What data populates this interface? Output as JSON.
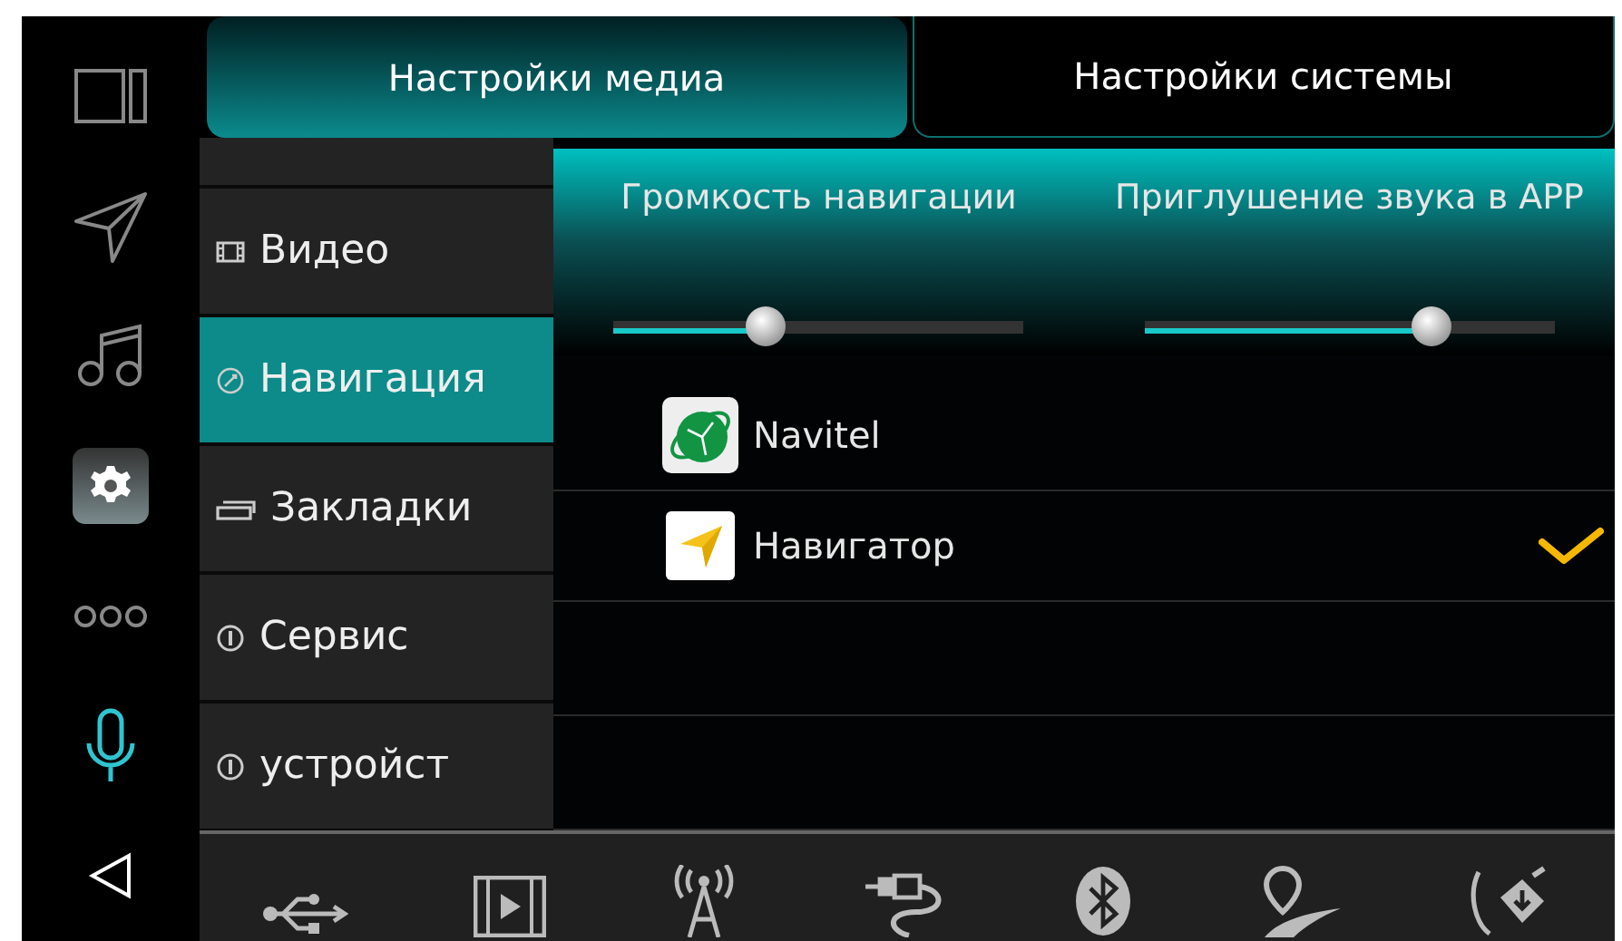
{
  "rail": [
    {
      "selected": false
    },
    {
      "selected": false
    },
    {
      "selected": false
    },
    {
      "selected": true
    },
    {
      "selected": false
    },
    {
      "selected": false,
      "active": true
    },
    {
      "selected": false
    }
  ],
  "tabs": [
    {
      "label": "Настройки медиа",
      "selected": true
    },
    {
      "label": "Настройки системы",
      "selected": false
    }
  ],
  "sidebar": {
    "items": [
      {
        "selected": false
      },
      {
        "label": "Видео",
        "selected": false
      },
      {
        "label": "Навигация",
        "selected": true
      },
      {
        "label": "Закладки",
        "selected": false
      },
      {
        "label": "Сервис",
        "selected": false
      },
      {
        "label": "устройст",
        "selected": false
      }
    ]
  },
  "sliders": [
    {
      "label": "Громкость навигации",
      "level": 0.37
    },
    {
      "label": "Приглушение звука в APP",
      "level": 0.7
    }
  ],
  "apps": [
    {
      "name": "Navitel",
      "selected": false
    },
    {
      "name": "Навигатор",
      "selected": true
    }
  ]
}
